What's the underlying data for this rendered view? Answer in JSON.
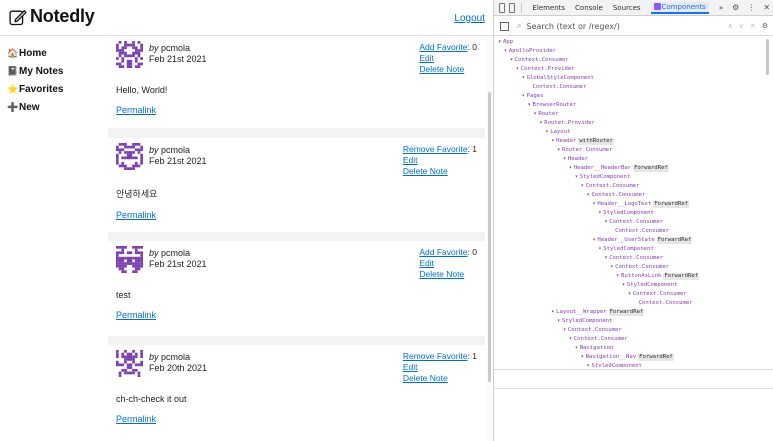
{
  "app": {
    "logo_text": "Notedly",
    "logout_label": "Logout",
    "nav": [
      {
        "icon": "home-icon",
        "glyph": "🏠",
        "label": "Home"
      },
      {
        "icon": "notebook-icon",
        "glyph": "📓",
        "label": "My Notes"
      },
      {
        "icon": "star-icon",
        "glyph": "⭐",
        "label": "Favorites"
      },
      {
        "icon": "plus-icon",
        "glyph": "➕",
        "label": "New"
      }
    ],
    "by_label": "by",
    "permalink_label": "Permalink",
    "edit_label": "Edit",
    "delete_label": "Delete Note",
    "notes": [
      {
        "author": "pcmola",
        "date": "Feb 21st 2021",
        "fav_label": "Add Favorite",
        "fav_count": ": 0",
        "content": "Hello, World!"
      },
      {
        "author": "pcmola",
        "date": "Feb 21st 2021",
        "fav_label": "Remove Favorite",
        "fav_count": ": 1",
        "content": "안녕하세요"
      },
      {
        "author": "pcmola",
        "date": "Feb 21st 2021",
        "fav_label": "Add Favorite",
        "fav_count": ": 0",
        "content": "test"
      },
      {
        "author": "pcmola",
        "date": "Feb 20th 2021",
        "fav_label": "Remove Favorite",
        "fav_count": ": 1",
        "content": "ch-ch-check it out"
      }
    ],
    "colors": {
      "link": "#0070d2",
      "avatar": "#7b3fb0",
      "main_bg": "#f3f3f3"
    }
  },
  "devtools": {
    "tabs": [
      "Elements",
      "Console",
      "Sources",
      "Components",
      "»"
    ],
    "active_tab": "Components",
    "search_placeholder": "Search (text or /regex/)",
    "tree": [
      {
        "depth": 0,
        "name": "App"
      },
      {
        "depth": 1,
        "name": "ApolloProvider"
      },
      {
        "depth": 2,
        "name": "Context.Consumer"
      },
      {
        "depth": 3,
        "name": "Context.Provider"
      },
      {
        "depth": 4,
        "name": "GlobalStyleComponent"
      },
      {
        "depth": 5,
        "name": "Context.Consumer"
      },
      {
        "depth": 4,
        "name": "Pages"
      },
      {
        "depth": 5,
        "name": "BrowserRouter"
      },
      {
        "depth": 6,
        "name": "Router"
      },
      {
        "depth": 7,
        "name": "Router.Provider"
      },
      {
        "depth": 8,
        "name": "Layout"
      },
      {
        "depth": 9,
        "name": "Header",
        "badge": "withRouter"
      },
      {
        "depth": 10,
        "name": "Router.Consumer"
      },
      {
        "depth": 11,
        "name": "Header"
      },
      {
        "depth": 12,
        "name": "Header__HeaderBar",
        "badge": "ForwardRef"
      },
      {
        "depth": 13,
        "name": "StyledComponent"
      },
      {
        "depth": 14,
        "name": "Context.Consumer"
      },
      {
        "depth": 15,
        "name": "Context.Consumer"
      },
      {
        "depth": 16,
        "name": "Header__LogoText",
        "badge": "ForwardRef"
      },
      {
        "depth": 17,
        "name": "StyledComponent"
      },
      {
        "depth": 18,
        "name": "Context.Consumer"
      },
      {
        "depth": 19,
        "name": "Context.Consumer"
      },
      {
        "depth": 16,
        "name": "Header__UserState",
        "badge": "ForwardRef"
      },
      {
        "depth": 17,
        "name": "StyledComponent"
      },
      {
        "depth": 18,
        "name": "Context.Consumer"
      },
      {
        "depth": 19,
        "name": "Context.Consumer"
      },
      {
        "depth": 20,
        "name": "ButtonAsLink",
        "badge": "ForwardRef"
      },
      {
        "depth": 21,
        "name": "StyledComponent"
      },
      {
        "depth": 22,
        "name": "Context.Consumer"
      },
      {
        "depth": 23,
        "name": "Context.Consumer"
      },
      {
        "depth": 9,
        "name": "Layout__Wrapper",
        "badge": "ForwardRef"
      },
      {
        "depth": 10,
        "name": "StyledComponent"
      },
      {
        "depth": 11,
        "name": "Context.Consumer"
      },
      {
        "depth": 12,
        "name": "Context.Consumer"
      },
      {
        "depth": 13,
        "name": "Navigation"
      },
      {
        "depth": 14,
        "name": "Navigation__Nav",
        "badge": "ForwardRef"
      },
      {
        "depth": 15,
        "name": "StyledComponent"
      }
    ],
    "colors": {
      "component_name": "#8a3ab9",
      "active_tab": "#1a73e8"
    }
  }
}
